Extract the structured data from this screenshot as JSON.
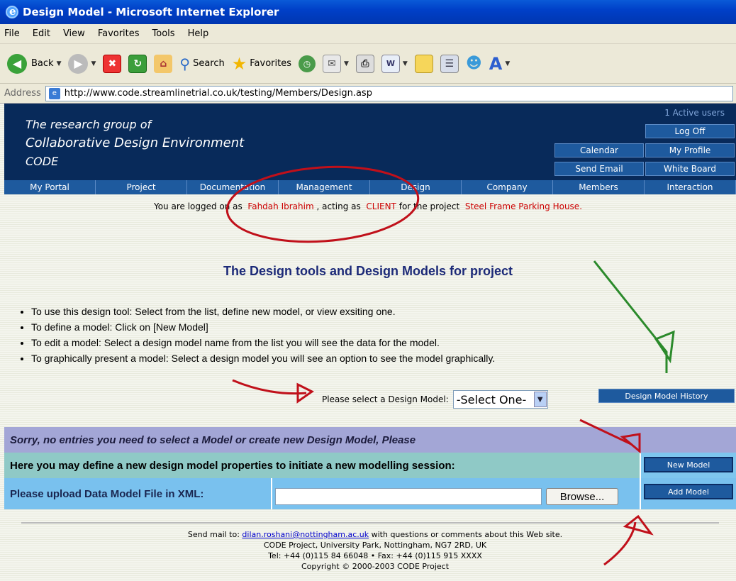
{
  "window": {
    "title": "Design Model - Microsoft Internet Explorer"
  },
  "menu": [
    "File",
    "Edit",
    "View",
    "Favorites",
    "Tools",
    "Help"
  ],
  "toolbar": {
    "back": "Back",
    "search": "Search",
    "favorites": "Favorites"
  },
  "address": {
    "label": "Address",
    "url": "http://www.code.streamlinetrial.co.uk/testing/Members/Design.asp"
  },
  "banner": {
    "line1": "The research group of",
    "line2": "Collaborative Design Environment",
    "line3": "CODE",
    "active_users": "1 Active users",
    "logoff": "Log Off",
    "calendar": "Calendar",
    "my_profile": "My Profile",
    "send_email": "Send Email",
    "white_board": "White Board"
  },
  "nav": [
    "My Portal",
    "Project",
    "Documentation",
    "Management",
    "Design",
    "Company",
    "Members",
    "Interaction"
  ],
  "login": {
    "pre": "You are logged on as",
    "user": "Fahdah Ibrahim",
    "mid": ", acting as",
    "role": "CLIENT",
    "post": "for the project",
    "project": "Steel Frame Parking House."
  },
  "heading": "The Design tools and Design Models for project",
  "bullets": [
    "To use this design tool: Select from the list, define new model, or view exsiting one.",
    "To define a model: Click on [New Model]",
    "To edit a model: Select a design model name from the list you will see the data for the model.",
    "To graphically present a model: Select a design model you will see an option to see the model graphically."
  ],
  "select": {
    "label": "Please select a Design Model:",
    "value": "-Select One-"
  },
  "history_button": "Design Model History",
  "rows": {
    "sorry": "Sorry, no entries you need to select a Model or create new Design Model, Please",
    "define": "Here you may define a new design model properties to initiate a new modelling session:",
    "upload": "Please upload Data Model File in XML:",
    "browse": "Browse...",
    "new_model": "New Model",
    "add_model": "Add Model"
  },
  "footer": {
    "mail_pre": "Send mail to:",
    "email": "dilan.roshani@nottingham.ac.uk",
    "mail_post": "with questions or comments about this Web site.",
    "address": "CODE Project, University Park, Nottingham, NG7 2RD, UK",
    "tel": "Tel: +44 (0)115 84 66048 • Fax: +44 (0)115 915 XXXX",
    "copyright": "Copyright © 2000-2003 CODE Project"
  }
}
